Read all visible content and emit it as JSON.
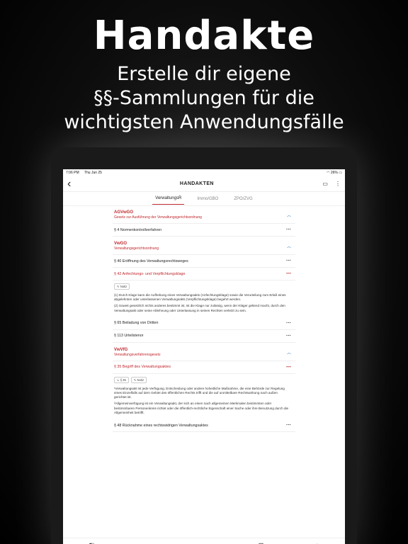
{
  "promo": {
    "title": "Handakte",
    "subtitle_lines": [
      "Erstelle dir eigene",
      "§§-Sammlungen für die",
      "wichtigsten Anwendungsfälle"
    ]
  },
  "statusbar": {
    "time": "7:06 PM",
    "date": "Thu Jun 25",
    "battery": "26%"
  },
  "topbar": {
    "title": "HANDAKTEN",
    "back_icon": "back-arrow-icon",
    "right_icons": [
      "tablet-icon",
      "more-vert-icon"
    ]
  },
  "tabs": [
    "VerwaltungsR",
    "Immo/GBO",
    "ZPO/ZVG"
  ],
  "laws": [
    {
      "name": "AGVwGO",
      "desc": "Gesetz zur Ausführung der Verwaltungsgerichtsordnung",
      "paras": [
        "§ 4 Normenkontrollverfahren"
      ]
    },
    {
      "name": "VwGO",
      "desc": "Verwaltungsgerichtsordnung",
      "paras": [
        "§ 40 Eröffnung des Verwaltungsrechtsweges",
        "§ 42 Anfechtungs- und Verpflichtungsklage",
        "§ 65 Beiladung von Dritten",
        "§ 113 Urteilstenor"
      ],
      "open_chip": "Notiz",
      "open_text": [
        "(1)  Durch Klage kann die Aufhebung eines Verwaltungsakts (Anfechtungsklage) sowie die Verurteilung zum Erlaß eines abgelehnten oder unterlassenen Verwaltungsakts (Verpflichtungsklage) begehrt werden.",
        "(2)  Soweit gesetzlich nichts anderes bestimmt ist, ist die Klage nur zulässig, wenn der Kläger geltend macht, durch den Verwaltungsakt oder seine Ablehnung oder Unterlassung in seinen Rechten verletzt zu sein."
      ]
    },
    {
      "name": "VwVfG",
      "desc": "Verwaltungsverfahrensgesetz",
      "paras": [
        "§ 35 Begriff des Verwaltungsaktes",
        "§ 48 Rücknahme eines rechtswidrigen Verwaltungsaktes"
      ],
      "open_chips": [
        "§ 35",
        "Notiz"
      ],
      "open_text": [
        "¹Verwaltungsakt ist jede Verfügung, Entscheidung oder andere hoheitliche Maßnahme, die eine Behörde zur Regelung eines Einzelfalls auf dem Gebiet des öffentlichen Rechts trifft und die auf unmittelbare Rechtswirkung nach außen gerichtet ist.",
        "²Allgemeinverfügung ist ein Verwaltungsakt, der sich an einen nach allgemeinen Merkmalen bestimmten oder bestimmbaren Personenkreis richtet oder die öffentlich-rechtliche Eigenschaft einer Sache oder ihre Benutzung durch die Allgemeinheit betrifft."
      ]
    }
  ],
  "bottom_nav": [
    "sidebar-icon",
    "folder-icon",
    "search-icon",
    "library-icon",
    "home-icon"
  ],
  "colors": {
    "accent": "#c0272d",
    "link": "#2b6fb0"
  }
}
